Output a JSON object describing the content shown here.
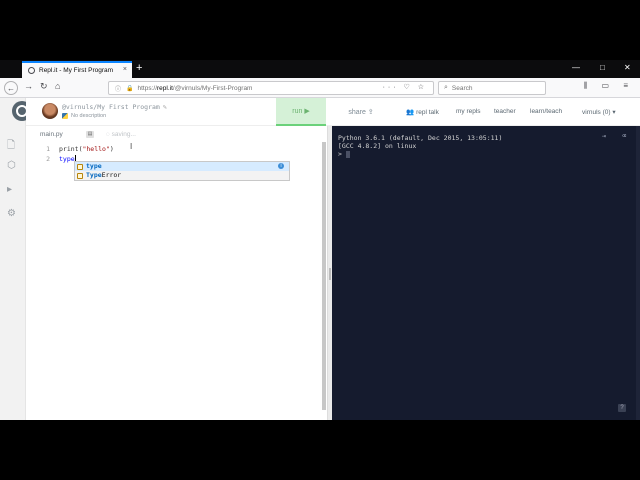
{
  "browser": {
    "tab_title": "Repl.it - My First Program",
    "tab_close": "×",
    "new_tab": "+",
    "window_minimize": "—",
    "window_maximize": "□",
    "window_close": "✕",
    "url_prefix": "https://",
    "url_host": "repl.it",
    "url_path": "/@virnuls/My-First-Program",
    "url_actions": "··· ♡ ☆",
    "search_placeholder": "Search",
    "toolbar_icons": "⫼ ▭ ≡"
  },
  "repl": {
    "owner_path": "@virnuls/My First Program",
    "description": "No description",
    "run_label": "run ▶",
    "share_label": "share ⇪"
  },
  "topnav": {
    "repl_talk": "repl talk",
    "my_repls": "my repls",
    "teacher": "teacher",
    "learn_teach": "learn/teach",
    "user": "virnuls (0) ▾"
  },
  "editor": {
    "file_name": "main.py",
    "status": "saving...",
    "line_numbers": [
      "1",
      "2"
    ],
    "line1_fn": "print(",
    "line1_str": "\"hello\"",
    "line1_end": ")",
    "line2_typed": "type",
    "suggestions": [
      {
        "match": "type",
        "rest": ""
      },
      {
        "match": "Type",
        "rest": "Error"
      }
    ]
  },
  "console": {
    "lines": [
      "Python 3.6.1 (default, Dec 2015, 13:05:11)",
      "[GCC 4.8.2] on linux"
    ],
    "prompt": ">",
    "help": "?"
  }
}
